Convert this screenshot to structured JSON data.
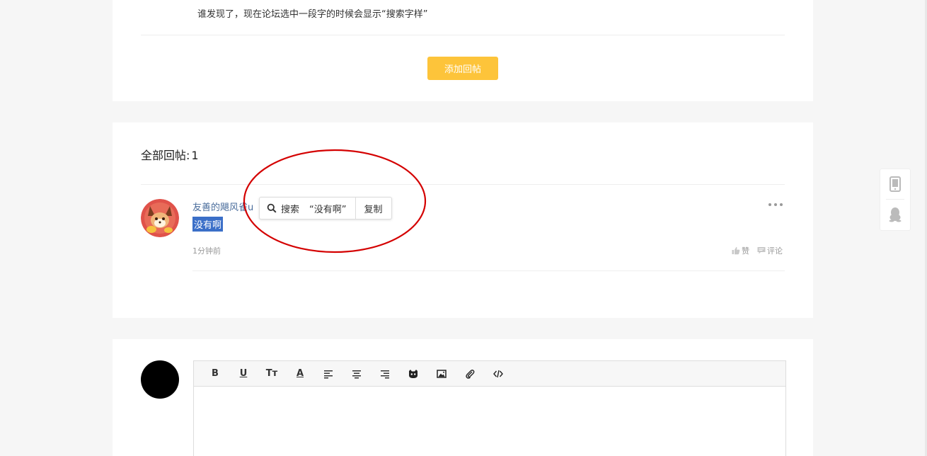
{
  "top_post": {
    "text": "谁发现了，现在论坛选中一段字的时候会显示“搜索字样”",
    "add_reply_label": "添加回帖"
  },
  "replies": {
    "title_label": "全部回帖:",
    "count": "1",
    "items": [
      {
        "username": "友善的飓风雀u",
        "content": "没有啊",
        "time": "1分钟前",
        "like_label": "赞",
        "comment_label": "评论"
      }
    ]
  },
  "selection_popup": {
    "search_label": "搜索",
    "search_query": "“没有啊”",
    "copy_label": "复制"
  },
  "editor": {
    "tools": [
      "bold-icon",
      "underline-icon",
      "text-size-icon",
      "font-color-icon",
      "align-left-icon",
      "align-center-icon",
      "align-right-icon",
      "emoji-icon",
      "image-icon",
      "attachment-icon",
      "code-icon"
    ],
    "bold_glyph": "B",
    "underline_glyph": "U",
    "text_size_glyph": "Tт",
    "font_color_glyph": "A"
  },
  "side_float": {
    "items": [
      "mobile-icon",
      "qq-icon"
    ]
  },
  "colors": {
    "accent_button": "#fdc43a",
    "selection_bg": "#3b6fc8",
    "annotation_red": "#d40000",
    "username": "#4a6d9c"
  }
}
